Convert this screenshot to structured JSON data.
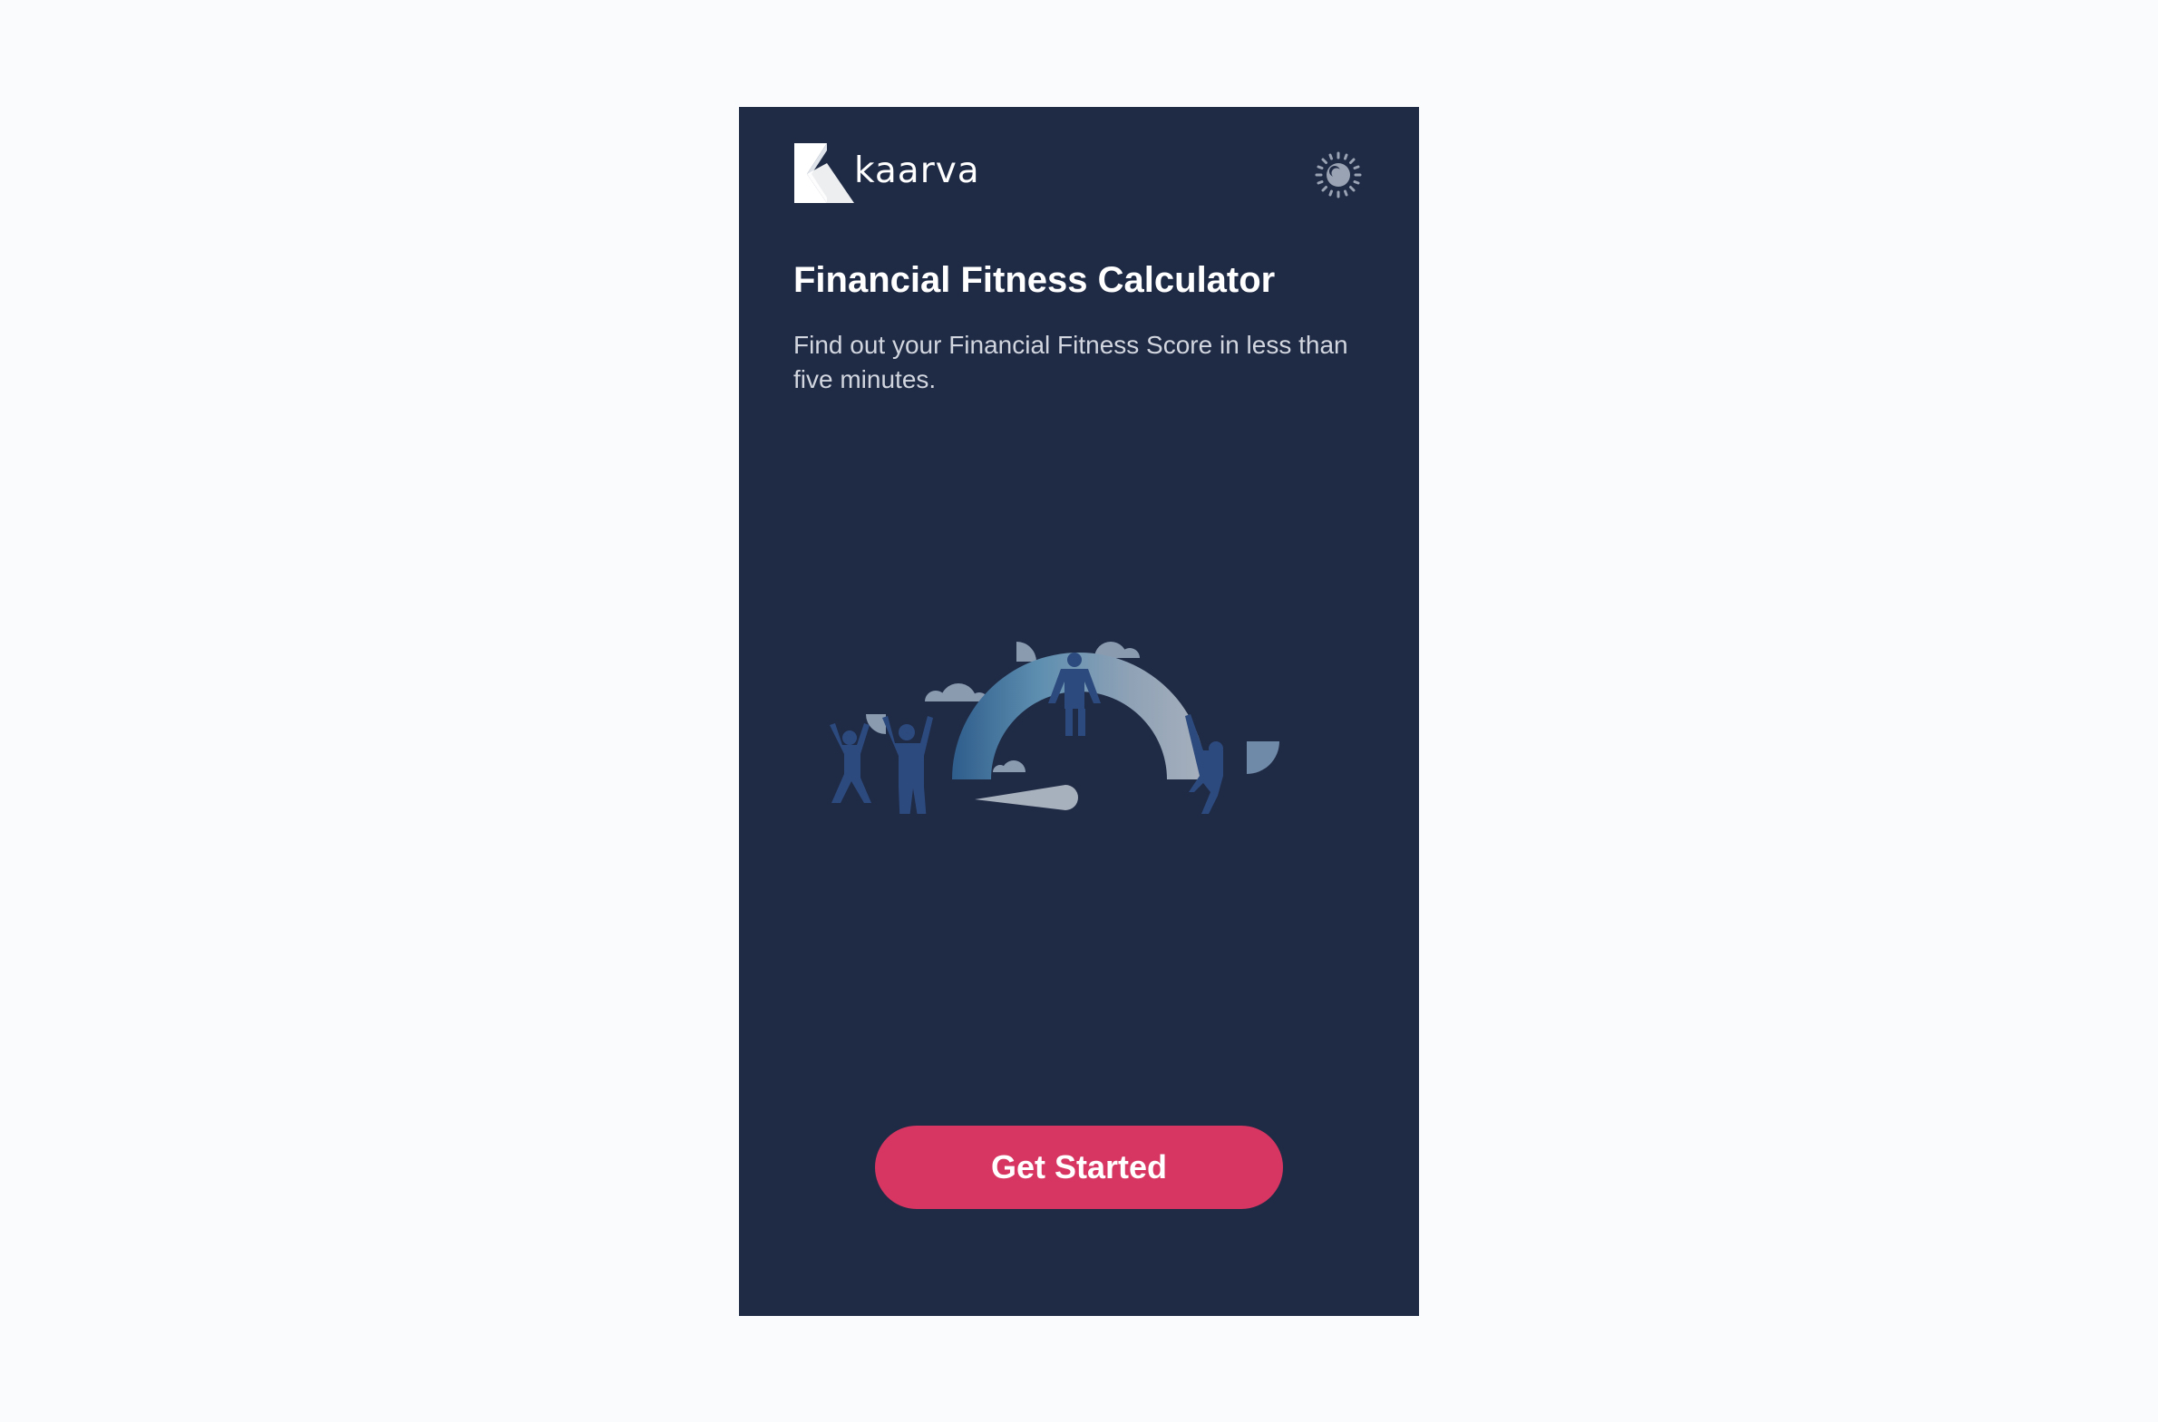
{
  "brand": {
    "name": "kaarva",
    "logo_icon": "kaarva-k-logo"
  },
  "header": {
    "theme_toggle_icon": "sun-moon-toggle-icon"
  },
  "hero": {
    "title": "Financial Fitness Calculator",
    "subtitle": "Find out your Financial Fitness Score in less than five minutes.",
    "illustration": "people-celebrating-around-gauge-illustration"
  },
  "cta": {
    "label": "Get Started"
  },
  "colors": {
    "background": "#fafbfc",
    "card": "#1f2a45",
    "accent": "#d63661",
    "text": "#ffffff",
    "muted_text": "#d2d6df",
    "figure_blue": "#2d4a7e",
    "cloud_gray": "#8a9bb0"
  }
}
